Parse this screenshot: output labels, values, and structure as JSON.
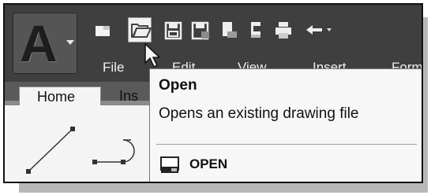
{
  "app_menu": {
    "letter": "A"
  },
  "quick_access": {
    "icons": [
      "new-icon",
      "open-icon",
      "save-icon",
      "save-as-icon",
      "open-from-web-icon",
      "save-to-web-icon",
      "plot-icon",
      "undo-icon"
    ]
  },
  "menubar": {
    "items": [
      "File",
      "Edit",
      "View",
      "Insert",
      "Format"
    ]
  },
  "ribbon": {
    "tabs": [
      "Home",
      "Ins"
    ],
    "tools": [
      "line-icon",
      "polyline-icon"
    ]
  },
  "tooltip": {
    "title": "Open",
    "description": "Opens an existing drawing file",
    "command": "OPEN"
  }
}
